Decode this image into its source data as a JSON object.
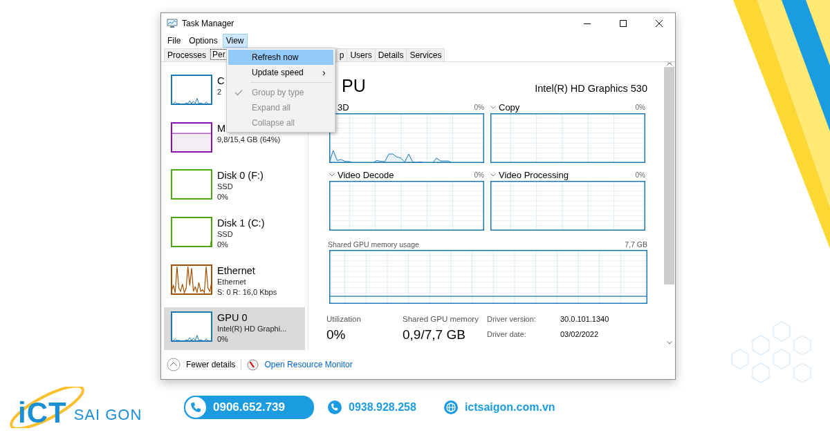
{
  "window": {
    "title": "Task Manager"
  },
  "menu_bar": [
    {
      "label": "File",
      "selected": false
    },
    {
      "label": "Options",
      "selected": false
    },
    {
      "label": "View",
      "selected": true
    }
  ],
  "view_menu": [
    {
      "kind": "item",
      "label": "Refresh now",
      "selected": true,
      "disabled": false,
      "checked": false
    },
    {
      "kind": "submenu",
      "label": "Update speed",
      "arrow": "›",
      "selected": false,
      "disabled": false,
      "checked": false
    },
    {
      "kind": "separator"
    },
    {
      "kind": "item",
      "label": "Group by type",
      "selected": false,
      "disabled": true,
      "checked": true
    },
    {
      "kind": "item",
      "label": "Expand all",
      "selected": false,
      "disabled": true,
      "checked": false
    },
    {
      "kind": "item",
      "label": "Collapse all",
      "selected": false,
      "disabled": true,
      "checked": false
    }
  ],
  "tabs": [
    {
      "label": "Processes",
      "selected": false
    },
    {
      "label": "Per",
      "selected": true
    },
    {
      "label": "p",
      "selected": false
    },
    {
      "label": "Users",
      "selected": false
    },
    {
      "label": "Details",
      "selected": false
    },
    {
      "label": "Services",
      "selected": false
    }
  ],
  "sidebar": {
    "items": [
      {
        "title": "C",
        "lines": [
          "2"
        ],
        "color": "#1a78b4",
        "kind": "low",
        "selected": false
      },
      {
        "title": "M",
        "lines": [
          "9,8/15,4 GB (64%)"
        ],
        "color": "#8b12ae",
        "kind": "fill",
        "selected": false
      },
      {
        "title": "Disk 0 (F:)",
        "lines": [
          "SSD",
          "0%"
        ],
        "color": "#4da60c",
        "kind": "flat",
        "selected": false
      },
      {
        "title": "Disk 1 (C:)",
        "lines": [
          "SSD",
          "0%"
        ],
        "color": "#4da60c",
        "kind": "blip",
        "selected": false
      },
      {
        "title": "Ethernet",
        "lines": [
          "Ethernet",
          "S: 0 R: 16,0 Kbps"
        ],
        "color": "#a74f01",
        "kind": "spiky",
        "selected": false
      },
      {
        "title": "GPU 0",
        "lines": [
          "Intel(R) HD Graphi...",
          "0%"
        ],
        "color": "#1a78b4",
        "kind": "low",
        "selected": true
      }
    ]
  },
  "gpu_panel": {
    "title": "PU",
    "device": "Intel(R) HD Graphics 530",
    "engines": [
      {
        "name": "3D",
        "percent": "0%",
        "kind": "low"
      },
      {
        "name": "Copy",
        "percent": "0%",
        "kind": "flat"
      },
      {
        "name": "Video Decode",
        "percent": "0%",
        "kind": "flat"
      },
      {
        "name": "Video Processing",
        "percent": "0%",
        "kind": "flat"
      }
    ],
    "shared_memory": {
      "label": "Shared GPU memory usage",
      "max": "7,7 GB"
    },
    "stats": [
      {
        "label": "Utilization",
        "value": "0%"
      },
      {
        "label": "Shared GPU memory",
        "value": "0,9/7,7 GB"
      }
    ],
    "driver": [
      {
        "label": "Driver version:",
        "value": "30.0.101.1340"
      },
      {
        "label": "Driver date:",
        "value": "03/02/2022"
      }
    ]
  },
  "footer": {
    "fewer_details": "Fewer details",
    "resource_monitor": "Open Resource Monitor"
  },
  "banner": {
    "logo_mark": "iCT",
    "logo_text": "SAI GON",
    "hotline": "0906.652.739",
    "phone": "0938.928.258",
    "website": "ictsaigon.com.vn"
  }
}
